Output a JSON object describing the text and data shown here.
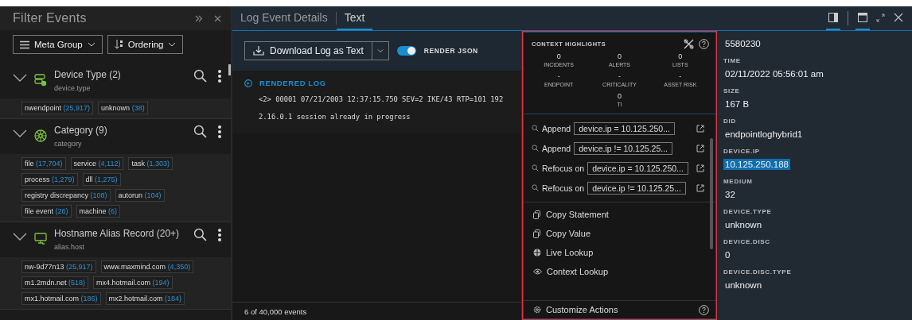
{
  "filter_panel": {
    "title": "Filter Events",
    "header_icons": [
      {
        "kind": "collapse"
      },
      {
        "kind": "close"
      }
    ],
    "buttons": [
      {
        "label": "Meta Group",
        "kind": "meta-group"
      },
      {
        "label": "Ordering",
        "kind": "ordering"
      }
    ],
    "groups": [
      {
        "title": "Device Type (2)",
        "field": "device.type",
        "kind": "device",
        "expanded": true,
        "tags": [
          {
            "label": "nwendpoint",
            "count": "(25,917)"
          },
          {
            "label": "unknown",
            "count": "(38)"
          }
        ]
      },
      {
        "title": "Category (9)",
        "field": "category",
        "kind": "category",
        "expanded": true,
        "tags": [
          {
            "label": "file",
            "count": "(17,704)"
          },
          {
            "label": "service",
            "count": "(4,112)"
          },
          {
            "label": "task",
            "count": "(1,303)"
          },
          {
            "label": "process",
            "count": "(1,279)"
          },
          {
            "label": "dll",
            "count": "(1,275)"
          },
          {
            "label": "registry discrepancy",
            "count": "(108)"
          },
          {
            "label": "autorun",
            "count": "(104)"
          },
          {
            "label": "file event",
            "count": "(26)"
          },
          {
            "label": "machine",
            "count": "(6)"
          }
        ]
      },
      {
        "title": "Hostname Alias Record (20+)",
        "field": "alias.host",
        "kind": "host",
        "expanded": true,
        "tags": [
          {
            "label": "nw-9d77n13",
            "count": "(25,917)"
          },
          {
            "label": "www.maxmind.com",
            "count": "(4,350)"
          },
          {
            "label": "m1.2mdn.net",
            "count": "(518)"
          },
          {
            "label": "mx4.hotmail.com",
            "count": "(194)"
          },
          {
            "label": "mx1.hotmail.com",
            "count": "(186)"
          },
          {
            "label": "mx2.hotmail.com",
            "count": "(184)"
          }
        ]
      }
    ]
  },
  "tabs": [
    {
      "label": "Log Event Details",
      "selected": false
    },
    {
      "label": "Text",
      "selected": true
    }
  ],
  "view_icons": [
    {
      "kind": "sidebar",
      "selected": true
    },
    {
      "kind": "window",
      "selected": true
    },
    {
      "kind": "expand",
      "selected": false
    },
    {
      "kind": "close",
      "selected": false
    }
  ],
  "toolbar": {
    "download_button": "Download Log as Text",
    "render_json": {
      "label": "RENDER JSON",
      "on": true
    }
  },
  "log": {
    "heading": "RENDERED LOG",
    "lines": [
      "<2> 00001 07/21/2003 12:37:15.750 SEV=2 IKE/43 RTP=101 192",
      "2.16.0.1 session already in progress"
    ]
  },
  "footer": "6 of 40,000 events",
  "context_menu": {
    "title": "CONTEXT HIGHLIGHTS",
    "stats": [
      {
        "value": "0",
        "label": "INCIDENTS"
      },
      {
        "value": "0",
        "label": "ALERTS"
      },
      {
        "value": "0",
        "label": "LISTS"
      },
      {
        "value": "-",
        "label": "ENDPOINT"
      },
      {
        "value": "-",
        "label": "CRITICALITY"
      },
      {
        "value": "-",
        "label": "ASSET RISK"
      },
      {
        "value": "0",
        "label": "TI"
      }
    ],
    "queries": [
      {
        "verb": "Append",
        "query": "device.ip = 10.125.250..."
      },
      {
        "verb": "Append",
        "query": "device.ip != 10.125.25..."
      },
      {
        "verb": "Refocus on",
        "query": "device.ip = 10.125.250..."
      },
      {
        "verb": "Refocus on",
        "query": "device.ip != 10.125.25..."
      }
    ],
    "actions": [
      {
        "label": "Copy Statement",
        "kind": "copy"
      },
      {
        "label": "Copy Value",
        "kind": "copy"
      },
      {
        "label": "Live Lookup",
        "kind": "live"
      },
      {
        "label": "Context Lookup",
        "kind": "context"
      }
    ],
    "footer": "Customize Actions"
  },
  "details": [
    {
      "value": "5580230",
      "selected": false
    },
    {
      "label": "TIME",
      "value": "02/11/2022 05:56:01 am",
      "selected": false
    },
    {
      "label": "SIZE",
      "value": "167 B",
      "selected": false
    },
    {
      "label": "DID",
      "value": "endpointloghybrid1",
      "selected": false
    },
    {
      "label": "DEVICE.IP",
      "value": "10.125.250.188",
      "selected": true
    },
    {
      "label": "MEDIUM",
      "value": "32",
      "selected": false
    },
    {
      "label": "DEVICE.TYPE",
      "value": "unknown",
      "selected": false
    },
    {
      "label": "DEVICE.DISC",
      "value": "0",
      "selected": false
    },
    {
      "label": "DEVICE.DISC.TYPE",
      "value": "unknown",
      "selected": false
    }
  ]
}
